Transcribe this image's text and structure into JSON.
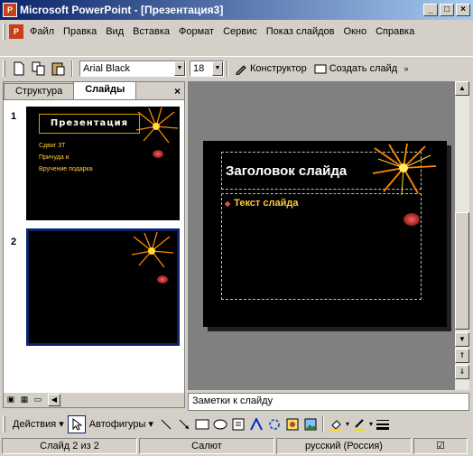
{
  "window": {
    "title": "Microsoft PowerPoint - [Презентация3]",
    "icon": "powerpoint-icon"
  },
  "menu": [
    "Файл",
    "Правка",
    "Вид",
    "Вставка",
    "Формат",
    "Сервис",
    "Показ слайдов",
    "Окно",
    "Справка"
  ],
  "toolbar": {
    "font_name": "Arial Black",
    "font_size": "18",
    "designer_label": "Конструктор",
    "new_slide_label": "Создать слайд"
  },
  "left_pane": {
    "tabs": [
      "Структура",
      "Слайды"
    ],
    "active_tab": "Слайды",
    "slides": [
      {
        "number": "1",
        "title": "Презентация",
        "bullets": [
          "Сдвиг 3Т",
          "Причуда и",
          "Вручение подарка"
        ]
      },
      {
        "number": "2"
      }
    ]
  },
  "slide": {
    "title": "Заголовок слайда",
    "text": "Текст слайда"
  },
  "notes": {
    "placeholder": "Заметки к слайду"
  },
  "drawing_toolbar": {
    "actions_label": "Действия",
    "autoshapes_label": "Автофигуры"
  },
  "status": {
    "slide": "Слайд 2 из 2",
    "design": "Салют",
    "language": "русский (Россия)"
  },
  "colors": {
    "accent": "#0a246a",
    "slide_bg": "#000000",
    "bullet_text": "#ffcc33"
  }
}
